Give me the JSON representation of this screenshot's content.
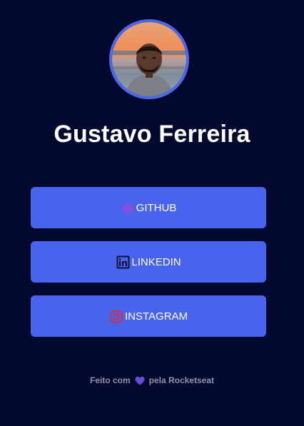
{
  "profile": {
    "name": "Gustavo Ferreira"
  },
  "links": [
    {
      "label": "GITHUB",
      "icon": "octocat-icon"
    },
    {
      "label": "LINKEDIN",
      "icon": "linkedin-icon"
    },
    {
      "label": "INSTAGRAM",
      "icon": "instagram-icon"
    }
  ],
  "footer": {
    "prefix": "Feito com",
    "suffix": "pela Rocketseat",
    "icon": "heart-icon"
  },
  "colors": {
    "background": "#02082e",
    "button": "#4864ec",
    "ring": "#4a68ec",
    "heart": "#6a4bd6"
  }
}
